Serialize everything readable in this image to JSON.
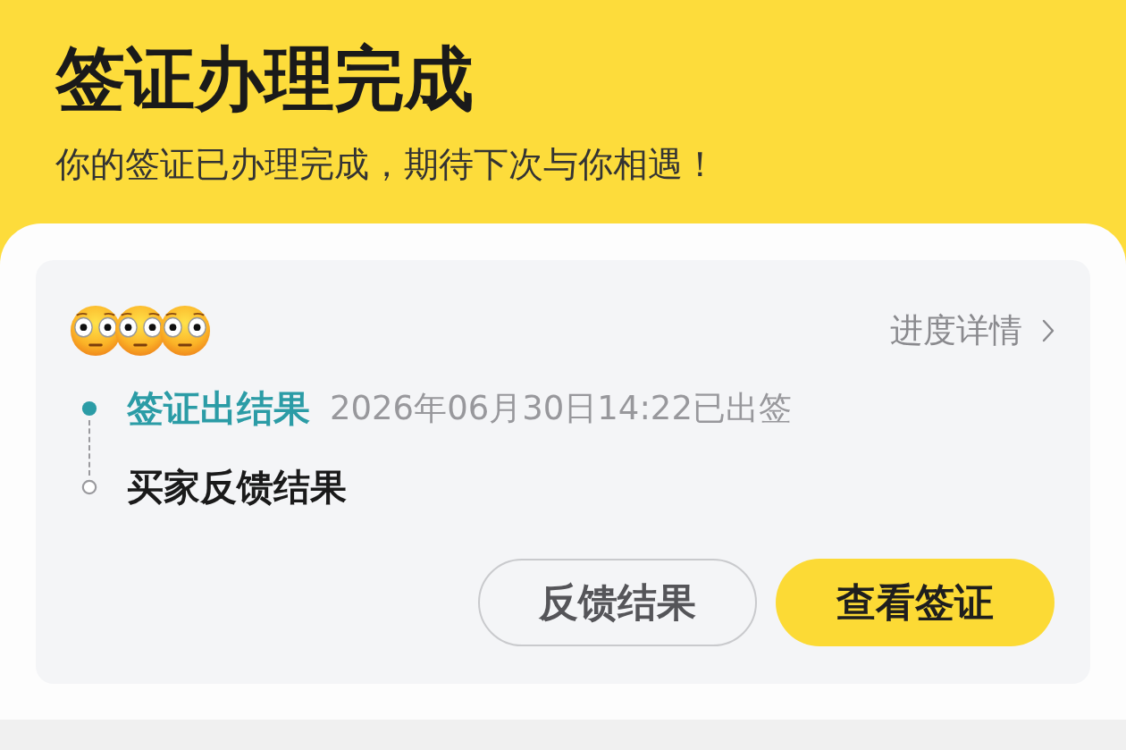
{
  "header": {
    "title": "签证办理完成",
    "subtitle": "你的签证已办理完成，期待下次与你相遇！"
  },
  "card": {
    "progress_link": "进度详情",
    "steps": [
      {
        "label": "签证出结果",
        "detail": "2026年06月30日14:22已出签",
        "completed": true
      },
      {
        "label": "买家反馈结果",
        "completed": false
      }
    ],
    "buttons": [
      {
        "label": "反馈结果",
        "kind": "secondary"
      },
      {
        "label": "查看签证",
        "kind": "primary"
      }
    ]
  }
}
